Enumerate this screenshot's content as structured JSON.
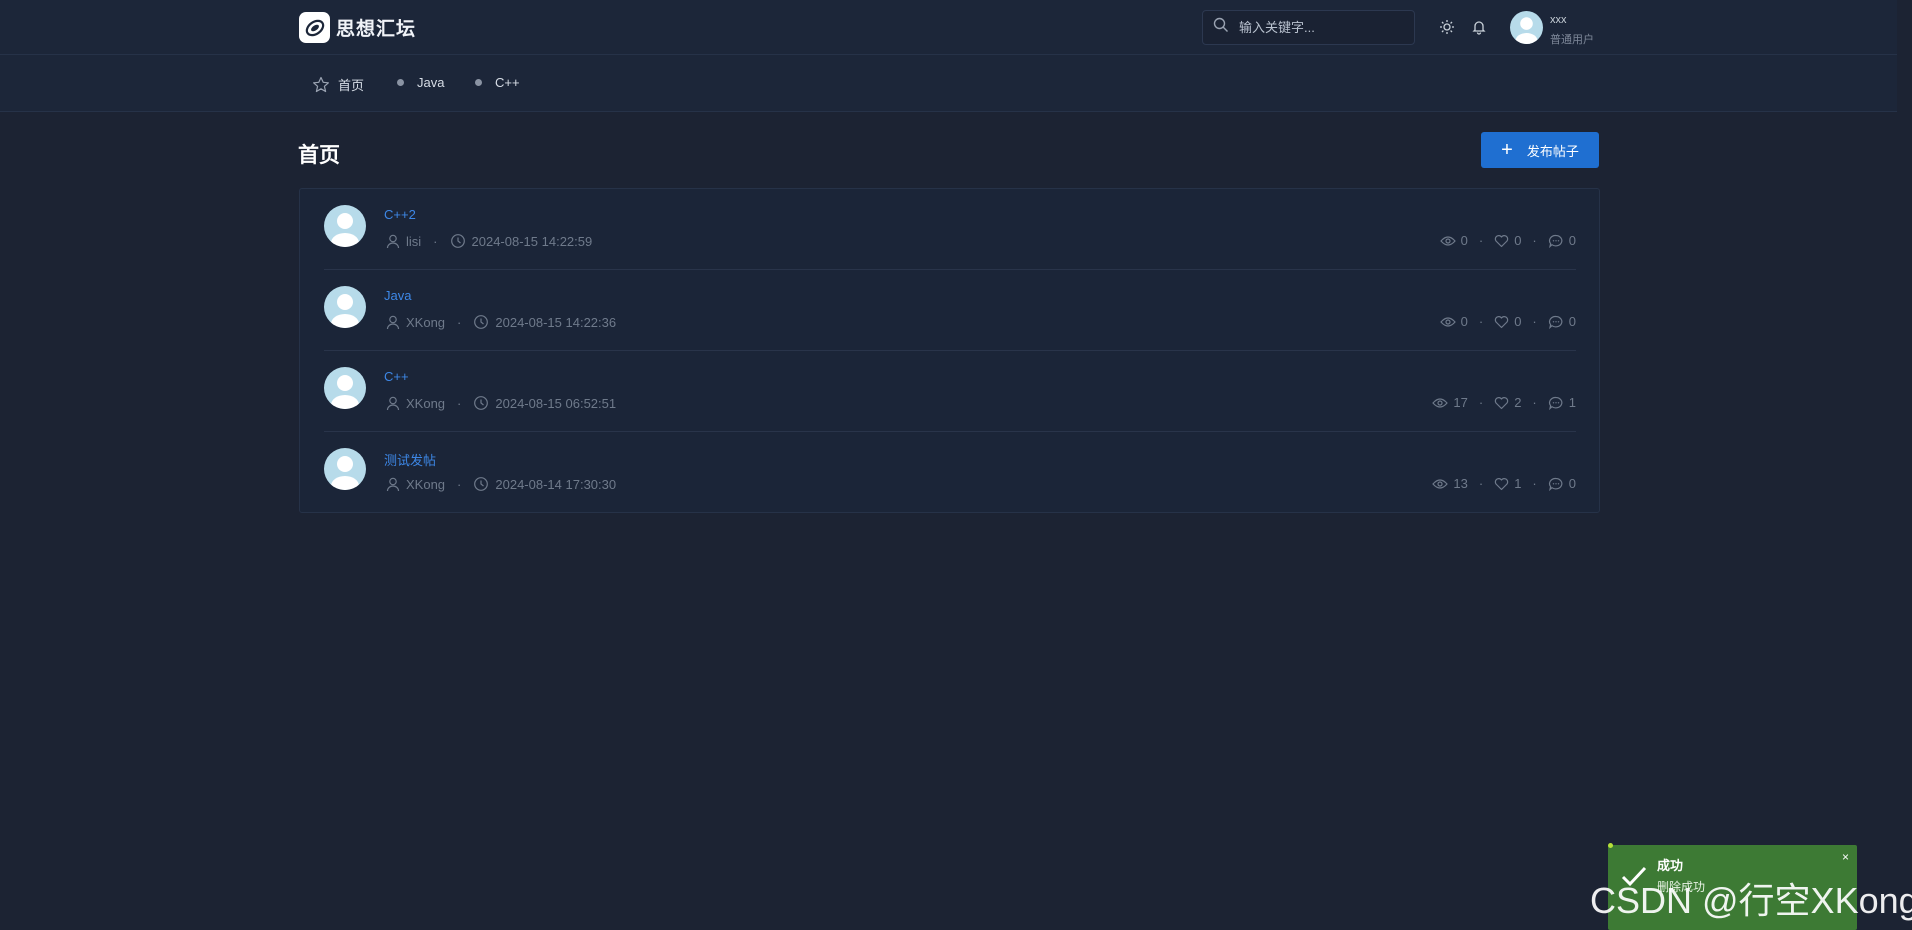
{
  "app": {
    "name": "思想汇坛"
  },
  "header": {
    "search_placeholder": "输入关键字...",
    "user": {
      "name": "xxx",
      "role": "普通用户"
    }
  },
  "nav": {
    "items": [
      {
        "label": "首页",
        "icon": "star-icon"
      },
      {
        "label": "Java",
        "icon": "dot-icon"
      },
      {
        "label": "C++",
        "icon": "dot-icon"
      }
    ]
  },
  "main": {
    "title": "首页",
    "publish_label": "发布帖子"
  },
  "posts": [
    {
      "title": "C++2",
      "author": "lisi",
      "time": "2024-08-15 14:22:59",
      "views": "0",
      "likes": "0",
      "comments": "0"
    },
    {
      "title": "Java",
      "author": "XKong",
      "time": "2024-08-15 14:22:36",
      "views": "0",
      "likes": "0",
      "comments": "0"
    },
    {
      "title": "C++",
      "author": "XKong",
      "time": "2024-08-15 06:52:51",
      "views": "17",
      "likes": "2",
      "comments": "1"
    },
    {
      "title": "测试发帖",
      "author": "XKong",
      "time": "2024-08-14 17:30:30",
      "views": "13",
      "likes": "1",
      "comments": "0"
    }
  ],
  "toast": {
    "title": "成功",
    "message": "删除成功",
    "close": "×"
  },
  "watermark": "CSDN @行空XKong",
  "colors": {
    "background": "#1c2333",
    "accent": "#1f6fd1",
    "link": "#3d87e6",
    "toast": "#3d7a34"
  }
}
